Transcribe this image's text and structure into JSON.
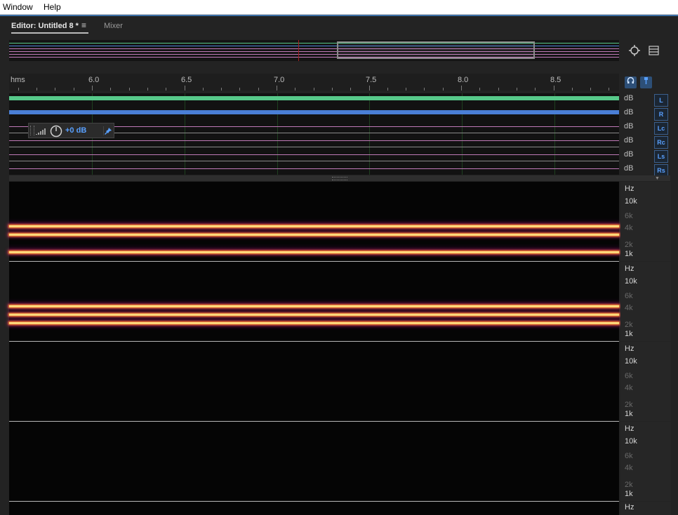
{
  "menu": {
    "window": "Window",
    "help": "Help"
  },
  "tabs": {
    "editor": "Editor: Untitled 8 *",
    "menu_icon": "≡",
    "mixer": "Mixer"
  },
  "ruler": {
    "unit": "hms",
    "labels": [
      "6.0",
      "6.5",
      "7.0",
      "7.5",
      "8.0",
      "8.5"
    ]
  },
  "channels": [
    {
      "db": "dB",
      "name": "L"
    },
    {
      "db": "dB",
      "name": "R"
    },
    {
      "db": "dB",
      "name": "Lc"
    },
    {
      "db": "dB",
      "name": "Rc"
    },
    {
      "db": "dB",
      "name": "Ls"
    },
    {
      "db": "dB",
      "name": "Rs"
    }
  ],
  "hud": {
    "gain": "+0 dB"
  },
  "spectral": {
    "scale": [
      {
        "hz": "Hz",
        "l10k": "10k",
        "l6k": "6k",
        "l4k": "4k",
        "l2k": "2k",
        "l1k": "1k"
      },
      {
        "hz": "Hz",
        "l10k": "10k",
        "l6k": "6k",
        "l4k": "4k",
        "l2k": "2k",
        "l1k": "1k"
      },
      {
        "hz": "Hz",
        "l10k": "10k",
        "l6k": "6k",
        "l4k": "4k",
        "l2k": "2k",
        "l1k": "1k"
      },
      {
        "hz": "Hz",
        "l10k": "10k",
        "l6k": "6k",
        "l4k": "4k",
        "l2k": "2k",
        "l1k": "1k"
      },
      {
        "hz": "Hz"
      }
    ]
  },
  "icons": {
    "zoom": "zoom-icon",
    "list": "list-view-icon",
    "headphones": "headphones-icon",
    "pin": "pin-icon"
  },
  "colors": {
    "accent": "#3b6ea5",
    "wave_green": "#57c98a",
    "wave_blue": "#4a7fd6",
    "spectral_hot": "#ffd87a"
  }
}
